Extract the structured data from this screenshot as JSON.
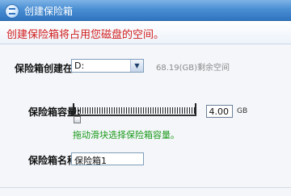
{
  "window": {
    "title": "创建保险箱",
    "icon": "safe-logo-icon"
  },
  "header": {
    "message": "创建保险箱将占用您磁盘的空间。",
    "color": "#d21e1e"
  },
  "drive": {
    "label": "保险箱创建在:",
    "selected": "D:",
    "free_space_text": "68.19(GB)剩余空间"
  },
  "capacity": {
    "label": "保险箱容量:",
    "value": "4.00",
    "unit": "GB",
    "slider_fraction": 0.0,
    "hint": "拖动滑块选择保险箱容量。",
    "hint_color": "#1a9a1a"
  },
  "name": {
    "label": "保险箱名称:",
    "value": "保险箱1"
  },
  "theme": {
    "titlebar": "#3f86cf",
    "background": "#f4f6f9"
  }
}
